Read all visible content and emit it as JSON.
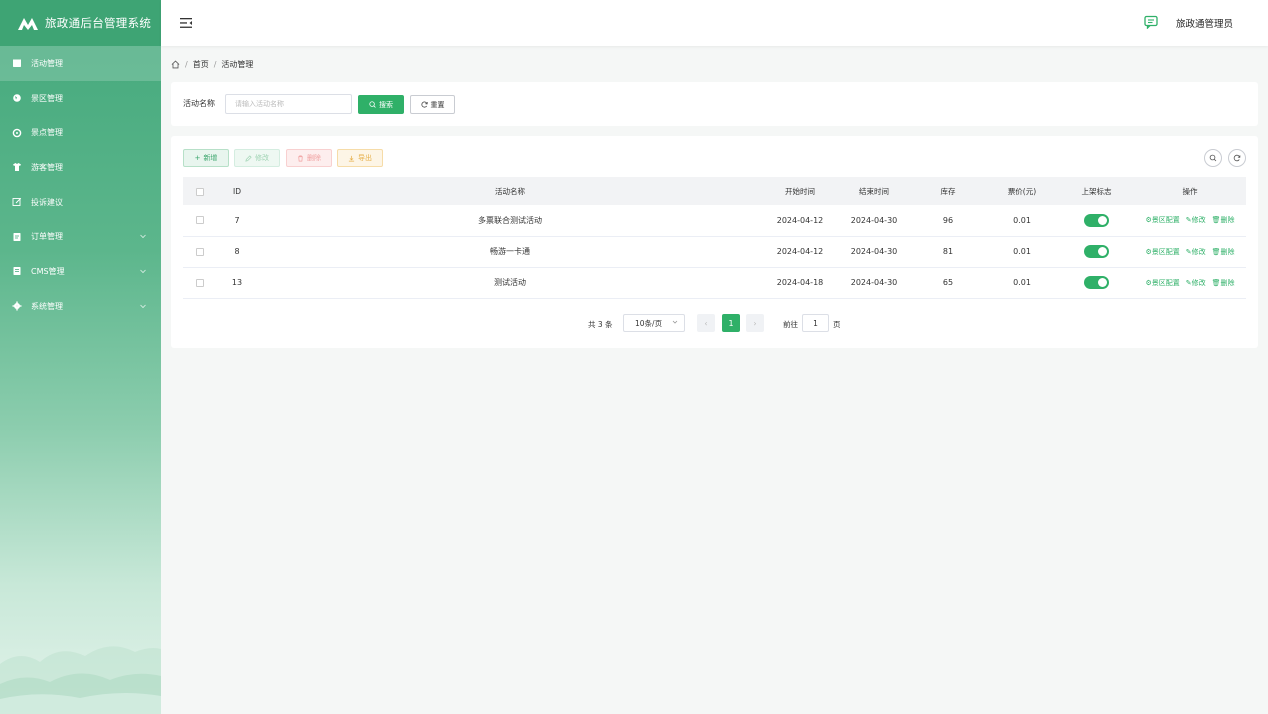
{
  "app": {
    "title": "旅政通后台管理系统"
  },
  "sidebar": {
    "items": [
      {
        "label": "活动管理",
        "icon": "calendar-icon",
        "active": true,
        "expandable": false
      },
      {
        "label": "景区管理",
        "icon": "globe-icon",
        "active": false,
        "expandable": false
      },
      {
        "label": "景点管理",
        "icon": "target-icon",
        "active": false,
        "expandable": false
      },
      {
        "label": "游客管理",
        "icon": "shirt-icon",
        "active": false,
        "expandable": false
      },
      {
        "label": "投诉建议",
        "icon": "edit-icon",
        "active": false,
        "expandable": false
      },
      {
        "label": "订单管理",
        "icon": "order-icon",
        "active": false,
        "expandable": true
      },
      {
        "label": "CMS管理",
        "icon": "cms-icon",
        "active": false,
        "expandable": true
      },
      {
        "label": "系统管理",
        "icon": "gear-icon",
        "active": false,
        "expandable": true
      }
    ]
  },
  "header": {
    "user_name": "旅政通管理员"
  },
  "breadcrumb": {
    "home": "首页",
    "current": "活动管理"
  },
  "search": {
    "label": "活动名称",
    "placeholder": "请输入活动名称",
    "search_button": "搜索",
    "reset_button": "重置"
  },
  "toolbar": {
    "add": "新增",
    "edit": "修改",
    "delete": "删除",
    "export": "导出"
  },
  "table": {
    "columns": [
      "ID",
      "活动名称",
      "开始时间",
      "结束时间",
      "库存",
      "票价(元)",
      "上架标志",
      "操作"
    ],
    "rows": [
      {
        "id": "7",
        "name": "多票联合测试活动",
        "start": "2024-04-12",
        "end": "2024-04-30",
        "stock": "96",
        "price": "0.01",
        "listed": true
      },
      {
        "id": "8",
        "name": "畅游一卡通",
        "start": "2024-04-12",
        "end": "2024-04-30",
        "stock": "81",
        "price": "0.01",
        "listed": true
      },
      {
        "id": "13",
        "name": "测试活动",
        "start": "2024-04-18",
        "end": "2024-04-30",
        "stock": "65",
        "price": "0.01",
        "listed": true
      }
    ],
    "actions": {
      "config": "景区配置",
      "edit": "修改",
      "delete": "删除"
    }
  },
  "pagination": {
    "total": "共 3 条",
    "page_size": "10条/页",
    "current_page": "1",
    "goto_label": "前往",
    "goto_value": "1",
    "page_suffix": "页"
  },
  "colors": {
    "primary": "#2fb068",
    "sidebar": "#43a87b"
  }
}
